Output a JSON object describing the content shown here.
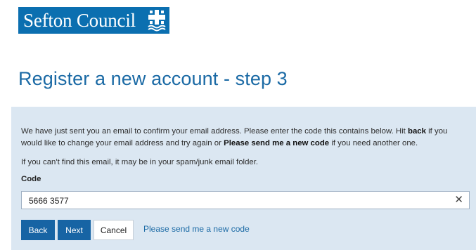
{
  "header": {
    "logo_text": "Sefton Council",
    "logo_icon": "sefton-crest-icon",
    "brand_color": "#0b6fb0"
  },
  "page": {
    "title": "Register a new account - step 3"
  },
  "form": {
    "intro": {
      "part1": "We have just sent you an email to confirm your email address. Please enter the code this contains below. Hit ",
      "back_word": "back",
      "part2": " if you would like to change your email address and try again or ",
      "resend_phrase": "Please send me a new code",
      "part3": " if you need another one."
    },
    "spam_note": "If you can't find this email, it may be in your spam/junk email folder.",
    "code_label": "Code",
    "code_value": "5666 3577",
    "clear_icon": "close-icon",
    "clear_glyph": "✕"
  },
  "actions": {
    "back_label": "Back",
    "next_label": "Next",
    "cancel_label": "Cancel",
    "resend_label": "Please send me a new code"
  },
  "colors": {
    "panel_bg": "#dbe7f2",
    "primary_button": "#1764a4",
    "title": "#1b6aa5"
  }
}
